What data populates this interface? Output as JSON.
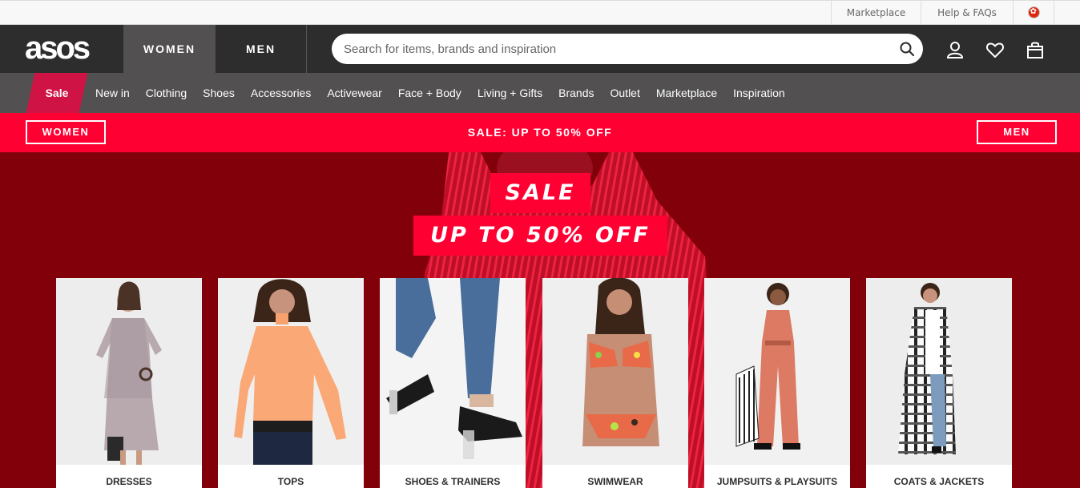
{
  "utility": {
    "marketplace": "Marketplace",
    "help": "Help & FAQs",
    "flag_icon": "hong-kong-flag-icon"
  },
  "header": {
    "logo": "asos",
    "tabs": [
      "WOMEN",
      "MEN"
    ],
    "active_tab": "WOMEN",
    "search_placeholder": "Search for items, brands and inspiration",
    "icons": [
      "search-icon",
      "account-icon",
      "heart-icon",
      "bag-icon"
    ]
  },
  "nav": {
    "sale": "Sale",
    "items": [
      "New in",
      "Clothing",
      "Shoes",
      "Accessories",
      "Activewear",
      "Face + Body",
      "Living + Gifts",
      "Brands",
      "Outlet",
      "Marketplace",
      "Inspiration"
    ]
  },
  "promo": {
    "women_button": "WOMEN",
    "text": "SALE: UP TO 50% OFF",
    "men_button": "MEN"
  },
  "hero": {
    "line1": "SALE",
    "line2": "UP TO 50% OFF"
  },
  "categories": [
    "DRESSES",
    "TOPS",
    "SHOES & TRAINERS",
    "SWIMWEAR",
    "JUMPSUITS & PLAYSUITS",
    "COATS & JACKETS"
  ],
  "colors": {
    "header_dark": "#2d2d2d",
    "nav_grey": "#525050",
    "sale_pink": "#d01345",
    "promo_red": "#ff0033",
    "hero_maroon": "#820009"
  }
}
